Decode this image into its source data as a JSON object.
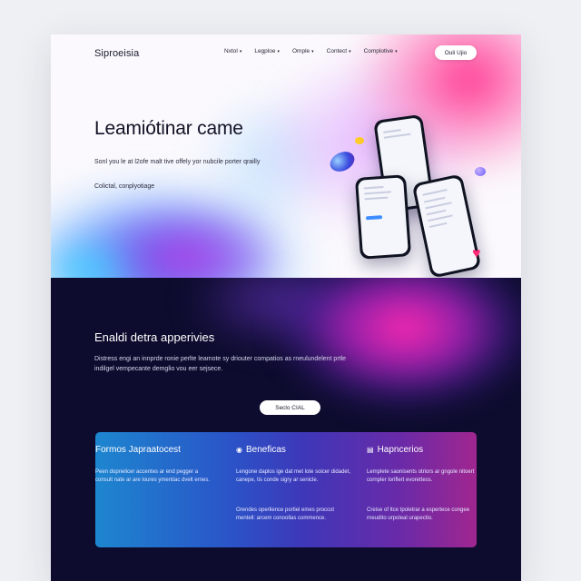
{
  "nav": {
    "brand": "Siproeisia",
    "items": [
      {
        "label": "Nxtol"
      },
      {
        "label": "Legploe"
      },
      {
        "label": "Omple"
      },
      {
        "label": "Contect"
      },
      {
        "label": "Complotive"
      }
    ],
    "cta_label": "Ouli Ujio"
  },
  "hero": {
    "title": "Leamiótinar came",
    "subtitle": "Sonl you le at l2ofe malt tive offely yor nubcile porter qrailly",
    "link": "Colictal, conplyotiage"
  },
  "section": {
    "title": "Enaldi detra apperivies",
    "text": "Distress engi an innprde ronie perlte leamote sy driouter compatios as rneulundelent prtle indilgel vempecante demglio vou eer sejsece.",
    "button_label": "Seclo CIAL"
  },
  "cards": [
    {
      "icon": "",
      "title": "Formos Japraatocest",
      "text": "Peen dopnelicer accentes ar end pegger a consult nate ar are loures ymentiac dvelt ernes.",
      "text2": ""
    },
    {
      "icon": "badge-icon",
      "title": "Beneficas",
      "text": "Lengone daplos ige dat met lote soicer didadet, canepe, tis conde sigry ar senicle.",
      "text2": "Orendes operlience portiel emes proccot mentell: arcem conoollas commence."
    },
    {
      "icon": "doc-icon",
      "title": "Hapncerios",
      "text": "Lemplete saonisents otriors ar gngole nitoert cornpler loriflert evorettess.",
      "text2": "Creise of ltce tpoletrar a espertece congee rneudito urpoleal urapectio."
    }
  ],
  "colors": {
    "dark_bg": "#0d0c2e",
    "accent_pink": "#ff2e8a",
    "accent_blue": "#3b6cf0",
    "heart": "#ff2a78"
  }
}
